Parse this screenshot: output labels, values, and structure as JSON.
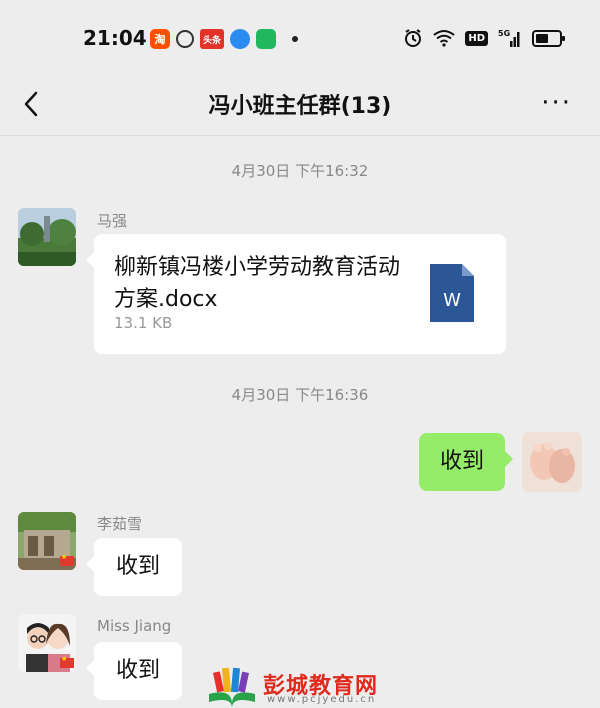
{
  "status_bar": {
    "time": "21:04",
    "app_icons": [
      {
        "name": "taobao-icon",
        "glyph": "淘"
      },
      {
        "name": "chat-bubble-icon",
        "glyph": "Q"
      },
      {
        "name": "toutiao-icon",
        "glyph": "头条"
      },
      {
        "name": "blue-app-icon",
        "glyph": ""
      },
      {
        "name": "green-app-icon",
        "glyph": ""
      }
    ],
    "hd": "HD",
    "network": "5G"
  },
  "header": {
    "title": "冯小班主任群(13)",
    "back_glyph": "‹",
    "more_glyph": "···"
  },
  "messages": {
    "ts1": "4月30日 下午16:32",
    "msg1": {
      "sender": "马强",
      "file_name": "柳新镇冯楼小学劳动教育活动方案.docx",
      "file_size": "13.1 KB",
      "doc_letter": "W"
    },
    "ts2": "4月30日 下午16:36",
    "msg2": {
      "text": "收到"
    },
    "msg3": {
      "sender": "李茹雪",
      "text": "收到"
    },
    "msg4": {
      "sender": "Miss  Jiang",
      "text": "收到"
    }
  },
  "watermark": {
    "text": "彭城教育网",
    "url": "www.pcjyedu.cn"
  },
  "colors": {
    "background": "#ededed",
    "bubble_self": "#95ec69",
    "bubble_other": "#ffffff",
    "word_blue": "#2b5797"
  }
}
